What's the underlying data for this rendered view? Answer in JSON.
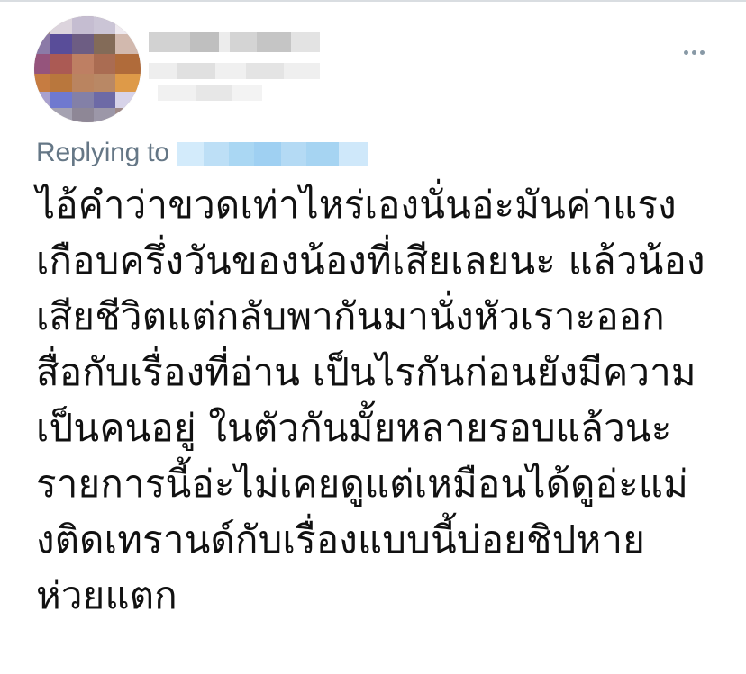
{
  "tweet": {
    "replying_to_label": "Replying to",
    "body": "ไอ้คำว่าขวดเท่าไหร่เองนั่นอ่ะมันค่าแรง\nเกือบครึ่งวันของน้องที่เสียเลยนะ แล้วน้อง\nเสียชีวิตแต่กลับพากันมานั่งหัวเราะออก\nสื่อกับเรื่องที่อ่าน เป็นไรกันก่อนยังมีความ\nเป็นคนอยู่ ในตัวกันมั้ยหลายรอบแล้วนะ\nรายการนี้อ่ะไม่เคยดูแต่เหมือนได้ดูอ่ะแม่\nงติดเทรานด์กับเรื่องแบบนี้บ่อยชิปหาย\nห่วยแตก"
  },
  "icons": {
    "menu": "more-options-icon"
  },
  "colors": {
    "text": "#111111",
    "secondary_text": "#657786",
    "menu_icon": "#8899a6",
    "handle_blur": "#9fd0f2"
  }
}
